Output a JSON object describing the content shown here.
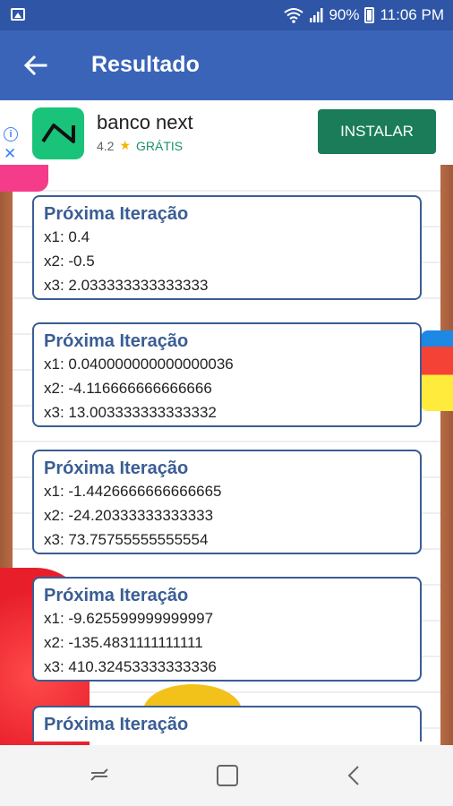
{
  "status_bar": {
    "battery": "90%",
    "time": "11:06 PM"
  },
  "app_bar": {
    "title": "Resultado"
  },
  "ad": {
    "app_name": "banco next",
    "rating": "4.2",
    "price": "GRÁTIS",
    "install_label": "INSTALAR"
  },
  "results": [
    {
      "heading": "Próxima Iteração",
      "x1": "x1: 0.4",
      "x2": "x2: -0.5",
      "x3": "x3: 2.033333333333333"
    },
    {
      "heading": "Próxima Iteração",
      "x1": "x1: 0.040000000000000036",
      "x2": "x2: -4.116666666666666",
      "x3": "x3: 13.003333333333332"
    },
    {
      "heading": "Próxima Iteração",
      "x1": "x1: -1.4426666666666665",
      "x2": "x2: -24.20333333333333",
      "x3": "x3: 73.75755555555554"
    },
    {
      "heading": "Próxima Iteração",
      "x1": "x1: -9.625599999999997",
      "x2": "x2: -135.4831111111111",
      "x3": "x3: 410.32453333333336"
    },
    {
      "heading": "Próxima Iteração"
    }
  ],
  "icons": {
    "back": "arrow-left-icon",
    "wifi": "wifi-icon",
    "signal": "signal-icon",
    "battery": "battery-icon",
    "gallery": "image-notification-icon"
  },
  "colors": {
    "status_bar": "#2f56a6",
    "app_bar": "#3a64b8",
    "card_border": "#3a5d94",
    "install_button": "#1a7c58"
  }
}
